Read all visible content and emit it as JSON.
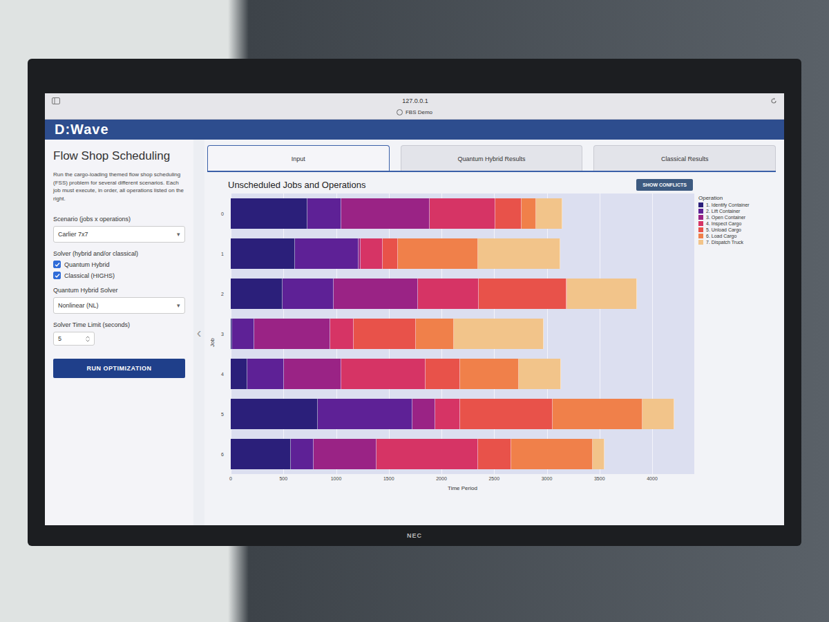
{
  "browser": {
    "address": "127.0.0.1",
    "tab": "FBS Demo"
  },
  "header": {
    "logo": "D:Wave"
  },
  "sidebar": {
    "title": "Flow Shop Scheduling",
    "description": "Run the cargo-loading themed flow shop scheduling (FSS) problem for several different scenarios. Each job must execute, in order, all operations listed on the right.",
    "scenario_label": "Scenario (jobs x operations)",
    "scenario_value": "Carlier 7x7",
    "solver_label": "Solver (hybrid and/or classical)",
    "solvers": [
      {
        "label": "Quantum Hybrid",
        "checked": true
      },
      {
        "label": "Classical (HIGHS)",
        "checked": true
      }
    ],
    "hybrid_label": "Quantum Hybrid Solver",
    "hybrid_value": "Nonlinear (NL)",
    "time_label": "Solver Time Limit (seconds)",
    "time_value": "5",
    "caret": "▾",
    "run_button": "RUN OPTIMIZATION",
    "collapse": "‹"
  },
  "tabs": [
    {
      "label": "Input",
      "selected": true
    },
    {
      "label": "Quantum Hybrid Results",
      "selected": false
    },
    {
      "label": "Classical Results",
      "selected": false
    }
  ],
  "chart": {
    "title": "Unscheduled Jobs and Operations",
    "conflicts_button": "SHOW CONFLICTS",
    "x_title": "Time Period",
    "y_title": "Job",
    "x_max": 4400,
    "x_ticks": [
      "0",
      "500",
      "1000",
      "1500",
      "2000",
      "2500",
      "3000",
      "3500",
      "4000"
    ],
    "legend_title": "Operation",
    "operations": [
      {
        "label": "1. Identify Container",
        "color": "#2b1f7a"
      },
      {
        "label": "2. Lift Container",
        "color": "#5e2196"
      },
      {
        "label": "3. Open Container",
        "color": "#9a2385"
      },
      {
        "label": "4. Inspect Cargo",
        "color": "#d63465"
      },
      {
        "label": "5. Unload Cargo",
        "color": "#e8524a"
      },
      {
        "label": "6. Load Cargo",
        "color": "#f0804a"
      },
      {
        "label": "7. Dispatch Truck",
        "color": "#f2c48a"
      }
    ],
    "jobs": [
      {
        "label": "0",
        "durations": [
          730,
          320,
          840,
          620,
          250,
          140,
          250
        ]
      },
      {
        "label": "1",
        "durations": [
          610,
          600,
          20,
          215,
          140,
          760,
          780
        ]
      },
      {
        "label": "2",
        "durations": [
          490,
          490,
          800,
          575,
          830,
          10,
          660
        ]
      },
      {
        "label": "3",
        "durations": [
          15,
          210,
          720,
          220,
          595,
          360,
          850
        ]
      },
      {
        "label": "4",
        "durations": [
          160,
          345,
          545,
          800,
          325,
          560,
          400
        ]
      },
      {
        "label": "5",
        "durations": [
          825,
          900,
          215,
          235,
          880,
          855,
          300
        ]
      },
      {
        "label": "6",
        "durations": [
          570,
          215,
          600,
          965,
          310,
          775,
          115
        ]
      }
    ]
  },
  "monitor": {
    "brand": "NEC"
  }
}
